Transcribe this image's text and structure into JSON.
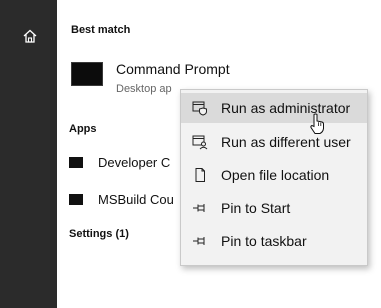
{
  "sidebar": {
    "home_icon": "home-icon"
  },
  "best_match": {
    "title": "Best match",
    "app_name": "Command Prompt",
    "app_type": "Desktop ap"
  },
  "apps": {
    "title": "Apps",
    "items": [
      {
        "label": "Developer C",
        "icon": "terminal-icon"
      },
      {
        "label": "MSBuild Cou",
        "icon": "terminal-icon"
      }
    ]
  },
  "settings": {
    "title": "Settings (1)"
  },
  "context_menu": {
    "items": [
      {
        "label": "Run as administrator",
        "icon": "shield-window-icon",
        "highlighted": true
      },
      {
        "label": "Run as different user",
        "icon": "user-window-icon",
        "highlighted": false
      },
      {
        "label": "Open file location",
        "icon": "file-icon",
        "highlighted": false
      },
      {
        "label": "Pin to Start",
        "icon": "pin-icon",
        "highlighted": false
      },
      {
        "label": "Pin to taskbar",
        "icon": "pin-icon",
        "highlighted": false
      }
    ]
  },
  "colors": {
    "rail": "#2b2b2b",
    "menu_bg": "#f2f2f2",
    "menu_hover": "#dadada"
  }
}
